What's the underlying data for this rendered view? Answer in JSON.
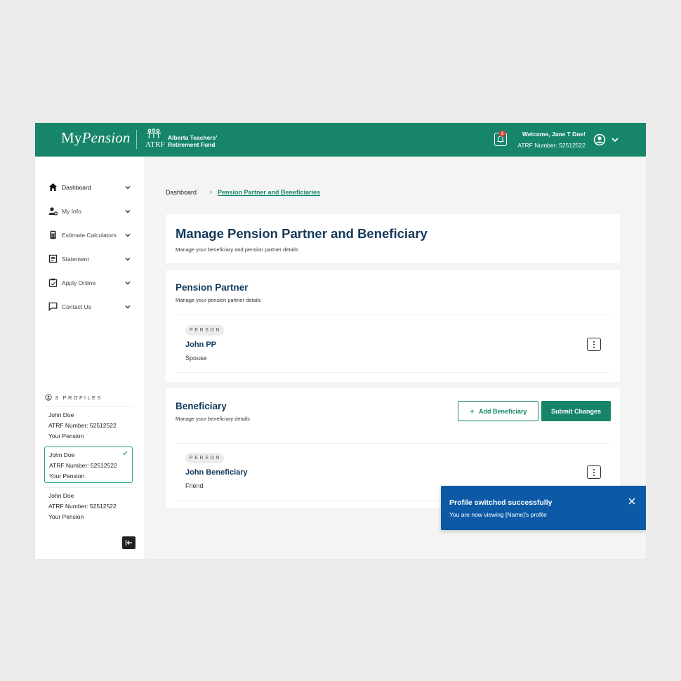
{
  "header": {
    "logo_my": "My",
    "logo_pension": "Pension",
    "org_short": "ATRF",
    "org_name_line1": "Alberta Teachers'",
    "org_name_line2": "Retirement Fund",
    "notification_count": "2",
    "welcome": "Welcome, Jane T Doe!",
    "atrf_number": "ATRF Number: 52512522",
    "brand_color": "#168569"
  },
  "sidebar": {
    "items": [
      {
        "label": "Dashboard",
        "icon": "home-icon"
      },
      {
        "label": "My Info",
        "icon": "user-settings-icon"
      },
      {
        "label": "Estimate Calculators",
        "icon": "calculator-icon"
      },
      {
        "label": "Statement",
        "icon": "document-icon"
      },
      {
        "label": "Apply Online",
        "icon": "clipboard-icon"
      },
      {
        "label": "Contact Us",
        "icon": "chat-icon"
      }
    ],
    "profiles_heading": "3 PROFILES",
    "profiles": [
      {
        "name": "John Doe",
        "number": "ATRF Number: 52512522",
        "tag": "Your Pension",
        "selected": false
      },
      {
        "name": "John Doe",
        "number": "ATRF Number: 52512522",
        "tag": "Your Pension",
        "selected": true
      },
      {
        "name": "John Doe",
        "number": "ATRF Number: 52512522",
        "tag": "Your Pension",
        "selected": false
      }
    ]
  },
  "breadcrumb": {
    "home": "Dashboard",
    "separator": "›",
    "current": "Pension Partner and Beneficiaries"
  },
  "page": {
    "title": "Manage Pension Partner and Beneficiary",
    "subtitle": "Manage your beneficiary and pension partner details"
  },
  "partner_section": {
    "title": "Pension Partner",
    "subtitle": "Manage your pension partner details",
    "person": {
      "chip": "PERSON",
      "name": "John PP",
      "relation": "Spouse"
    }
  },
  "beneficiary_section": {
    "title": "Beneficiary",
    "subtitle": "Manage your beneficiary details",
    "add_label": "Add Beneficiary",
    "submit_label": "Submit Changes",
    "person": {
      "chip": "PERSON",
      "name": "John Beneficiary",
      "relation": "Friend"
    }
  },
  "toast": {
    "title": "Profile switched successfully",
    "message": "You are now viewing [Name]'s profile",
    "color": "#0c5aa6"
  }
}
